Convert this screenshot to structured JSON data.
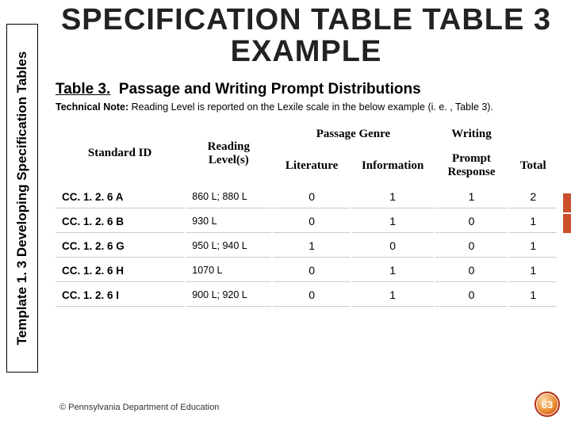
{
  "sidebar": {
    "label": "Template 1. 3 Developing Specification Tables"
  },
  "title": "SPECIFICATION TABLE TABLE 3 EXAMPLE",
  "caption": {
    "num": "Table 3.",
    "desc": "Passage and Writing Prompt Distributions"
  },
  "tech_note": {
    "lead": "Technical Note:",
    "body": " Reading Level is reported on the Lexile scale in the below example (i. e. , Table 3)."
  },
  "headers": {
    "standard": "Standard ID",
    "reading": "Reading Level(s)",
    "group_passage": "Passage Genre",
    "group_writing": "Writing",
    "literature": "Literature",
    "information": "Information",
    "prompt": "Prompt Response",
    "total": "Total"
  },
  "rows": [
    {
      "id": "CC. 1. 2. 6 A",
      "rl": "860 L; 880 L",
      "lit": "0",
      "info": "1",
      "prompt": "1",
      "total": "2"
    },
    {
      "id": "CC. 1. 2. 6 B",
      "rl": "930 L",
      "lit": "0",
      "info": "1",
      "prompt": "0",
      "total": "1"
    },
    {
      "id": "CC. 1. 2. 6 G",
      "rl": "950 L; 940 L",
      "lit": "1",
      "info": "0",
      "prompt": "0",
      "total": "1"
    },
    {
      "id": "CC. 1. 2. 6 H",
      "rl": "1070 L",
      "lit": "0",
      "info": "1",
      "prompt": "0",
      "total": "1"
    },
    {
      "id": "CC. 1. 2. 6 I",
      "rl": "900 L; 920 L",
      "lit": "0",
      "info": "1",
      "prompt": "0",
      "total": "1"
    }
  ],
  "footer": "© Pennsylvania Department of Education",
  "page": "63",
  "chart_data": {
    "type": "table",
    "title": "Table 3. Passage and Writing Prompt Distributions",
    "columns": [
      "Standard ID",
      "Reading Level(s)",
      "Literature",
      "Information",
      "Prompt Response",
      "Total"
    ],
    "column_groups": {
      "Passage Genre": [
        "Literature",
        "Information"
      ],
      "Writing": [
        "Prompt Response"
      ]
    },
    "data": [
      [
        "CC. 1. 2. 6 A",
        "860 L; 880 L",
        0,
        1,
        1,
        2
      ],
      [
        "CC. 1. 2. 6 B",
        "930 L",
        0,
        1,
        0,
        1
      ],
      [
        "CC. 1. 2. 6 G",
        "950 L; 940 L",
        1,
        0,
        0,
        1
      ],
      [
        "CC. 1. 2. 6 H",
        "1070 L",
        0,
        1,
        0,
        1
      ],
      [
        "CC. 1. 2. 6 I",
        "900 L; 920 L",
        0,
        1,
        0,
        1
      ]
    ]
  }
}
